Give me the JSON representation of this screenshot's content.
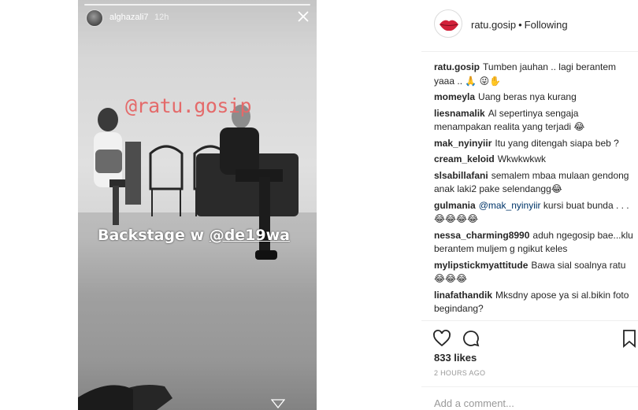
{
  "story": {
    "username": "alghazali7",
    "time": "12h",
    "watermark": "@ratu.gosip",
    "caption_prefix": "Backstage w ",
    "caption_mention": "@de19wa"
  },
  "post": {
    "username": "ratu.gosip",
    "separator": "•",
    "follow_status": "Following",
    "likes": "833 likes",
    "timestamp": "2 HOURS AGO",
    "add_comment_placeholder": "Add a comment..."
  },
  "comments": [
    {
      "user": "ratu.gosip",
      "text": "Tumben jauhan .. lagi berantem yaaa .. 🙏 😜✋"
    },
    {
      "user": "momeyla",
      "text": "Uang beras nya kurang"
    },
    {
      "user": "liesnamalik",
      "text": "Al sepertinya sengaja menampakan realita yang terjadi 😂"
    },
    {
      "user": "mak_nyinyiir",
      "text": "Itu yang ditengah siapa beb ?"
    },
    {
      "user": "cream_keloid",
      "text": "Wkwkwkwk"
    },
    {
      "user": "slsabillafani",
      "text": "semalem mbaa mulaan gendong anak laki2 pake selendangg😂"
    },
    {
      "user": "gulmania",
      "mention": "@mak_nyinyiir",
      "text": "kursi buat bunda . . . 😂😂😂😂"
    },
    {
      "user": "nessa_charming8990",
      "text": "aduh ngegosip bae...klu berantem muljem g ngikut keles"
    },
    {
      "user": "mylipstickmyattitude",
      "text": "Bawa sial soalnya ratu 😂😂😂"
    },
    {
      "user": "linafathandik",
      "text": "Mksdny apose ya si al.bikin foto begindang?"
    }
  ],
  "icons": {
    "like": "heart-icon",
    "comment": "comment-bubble-icon",
    "save": "bookmark-icon",
    "close": "close-icon",
    "share": "send-icon"
  },
  "colors": {
    "watermark": "#e46a6a",
    "link": "#003569",
    "muted": "#999999",
    "text": "#262626"
  }
}
